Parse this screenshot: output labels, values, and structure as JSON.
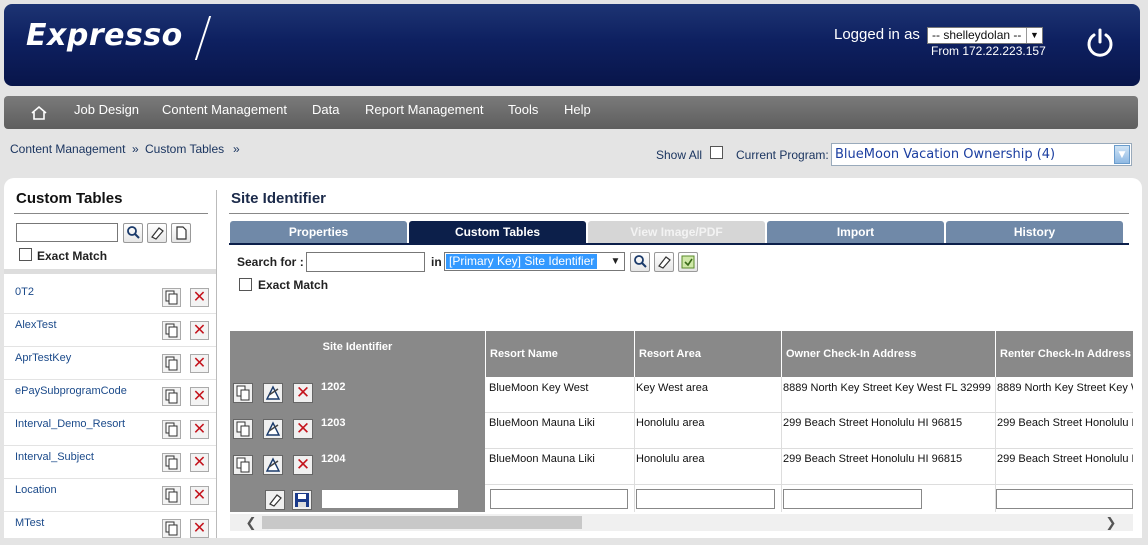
{
  "header": {
    "logo_text": "Expresso",
    "logged_in_label": "Logged in as",
    "user_value": "-- shelleydolan --",
    "from_ip": "From 172.22.223.157"
  },
  "nav": {
    "items": [
      "Job Design",
      "Content Management",
      "Data",
      "Report Management",
      "Tools",
      "Help"
    ]
  },
  "breadcrumb": {
    "items": [
      "Content Management",
      "Custom Tables"
    ],
    "separator": "»"
  },
  "program": {
    "show_all_label": "Show All",
    "current_program_label": "Current Program:",
    "value": "BlueMoon Vacation Ownership (4)"
  },
  "left_panel": {
    "title": "Custom Tables",
    "exact_match_label": "Exact Match",
    "tables": [
      "0T2",
      "AlexTest",
      "AprTestKey",
      "ePaySubprogramCode",
      "Interval_Demo_Resort",
      "Interval_Subject",
      "Location",
      "MTest"
    ]
  },
  "right_panel": {
    "title": "Site Identifier",
    "tabs": [
      "Properties",
      "Custom Tables",
      "View Image/PDF",
      "Import",
      "History"
    ],
    "search_for_label": "Search for :",
    "in_label": "in",
    "field_select_value": "[Primary Key] Site Identifier",
    "exact_match_label": "Exact Match",
    "grid": {
      "columns": [
        "Site Identifier",
        "Resort Name",
        "Resort Area",
        "Owner Check-In Address",
        "Renter Check-In Address"
      ],
      "rows": [
        [
          "1202",
          "BlueMoon Key West",
          "Key West area",
          "8889 North Key Street Key West FL 32999",
          "8889 North Key Street Key W"
        ],
        [
          "1203",
          "BlueMoon Mauna Liki",
          "Honolulu area",
          "299 Beach Street Honolulu HI 96815",
          "299 Beach Street Honolulu H"
        ],
        [
          "1204",
          "BlueMoon Mauna Liki",
          "Honolulu area",
          "299 Beach Street Honolulu HI 96815",
          "299 Beach Street Honolulu H"
        ]
      ]
    }
  },
  "colors": {
    "header_bg": "#0e2060",
    "nav_bg": "#6b6b6b",
    "active_tab": "#0c1f4a",
    "tab": "#7089a8",
    "delete_red": "#c4141d",
    "link_blue": "#1b4a8a"
  }
}
